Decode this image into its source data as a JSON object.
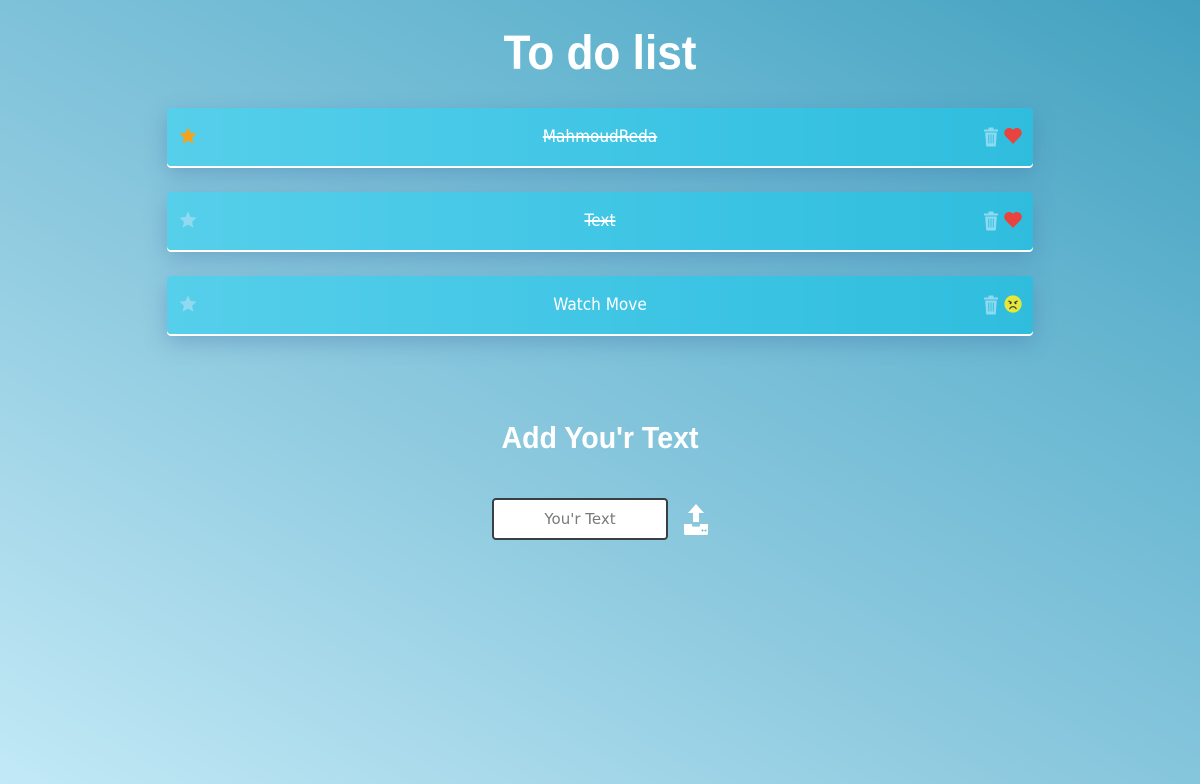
{
  "header": {
    "title": "To do list"
  },
  "tasks": [
    {
      "text": "MahmoudReda",
      "completed": true,
      "starred": true,
      "status_icon": "heart-icon"
    },
    {
      "text": "Text",
      "completed": true,
      "starred": false,
      "status_icon": "heart-icon"
    },
    {
      "text": "Watch Move",
      "completed": false,
      "starred": false,
      "status_icon": "sad-face-icon"
    }
  ],
  "add_section": {
    "title": "Add You'r Text",
    "input_placeholder": "You'r Text",
    "input_value": "",
    "button_icon": "upload-icon"
  },
  "colors": {
    "star_active": "#f5a21c",
    "star_inactive": "#8fdaf0",
    "trash": "#8fdaf0",
    "heart": "#e8433f",
    "sad_face": "#e4e83a",
    "card": "#45c8e6"
  }
}
